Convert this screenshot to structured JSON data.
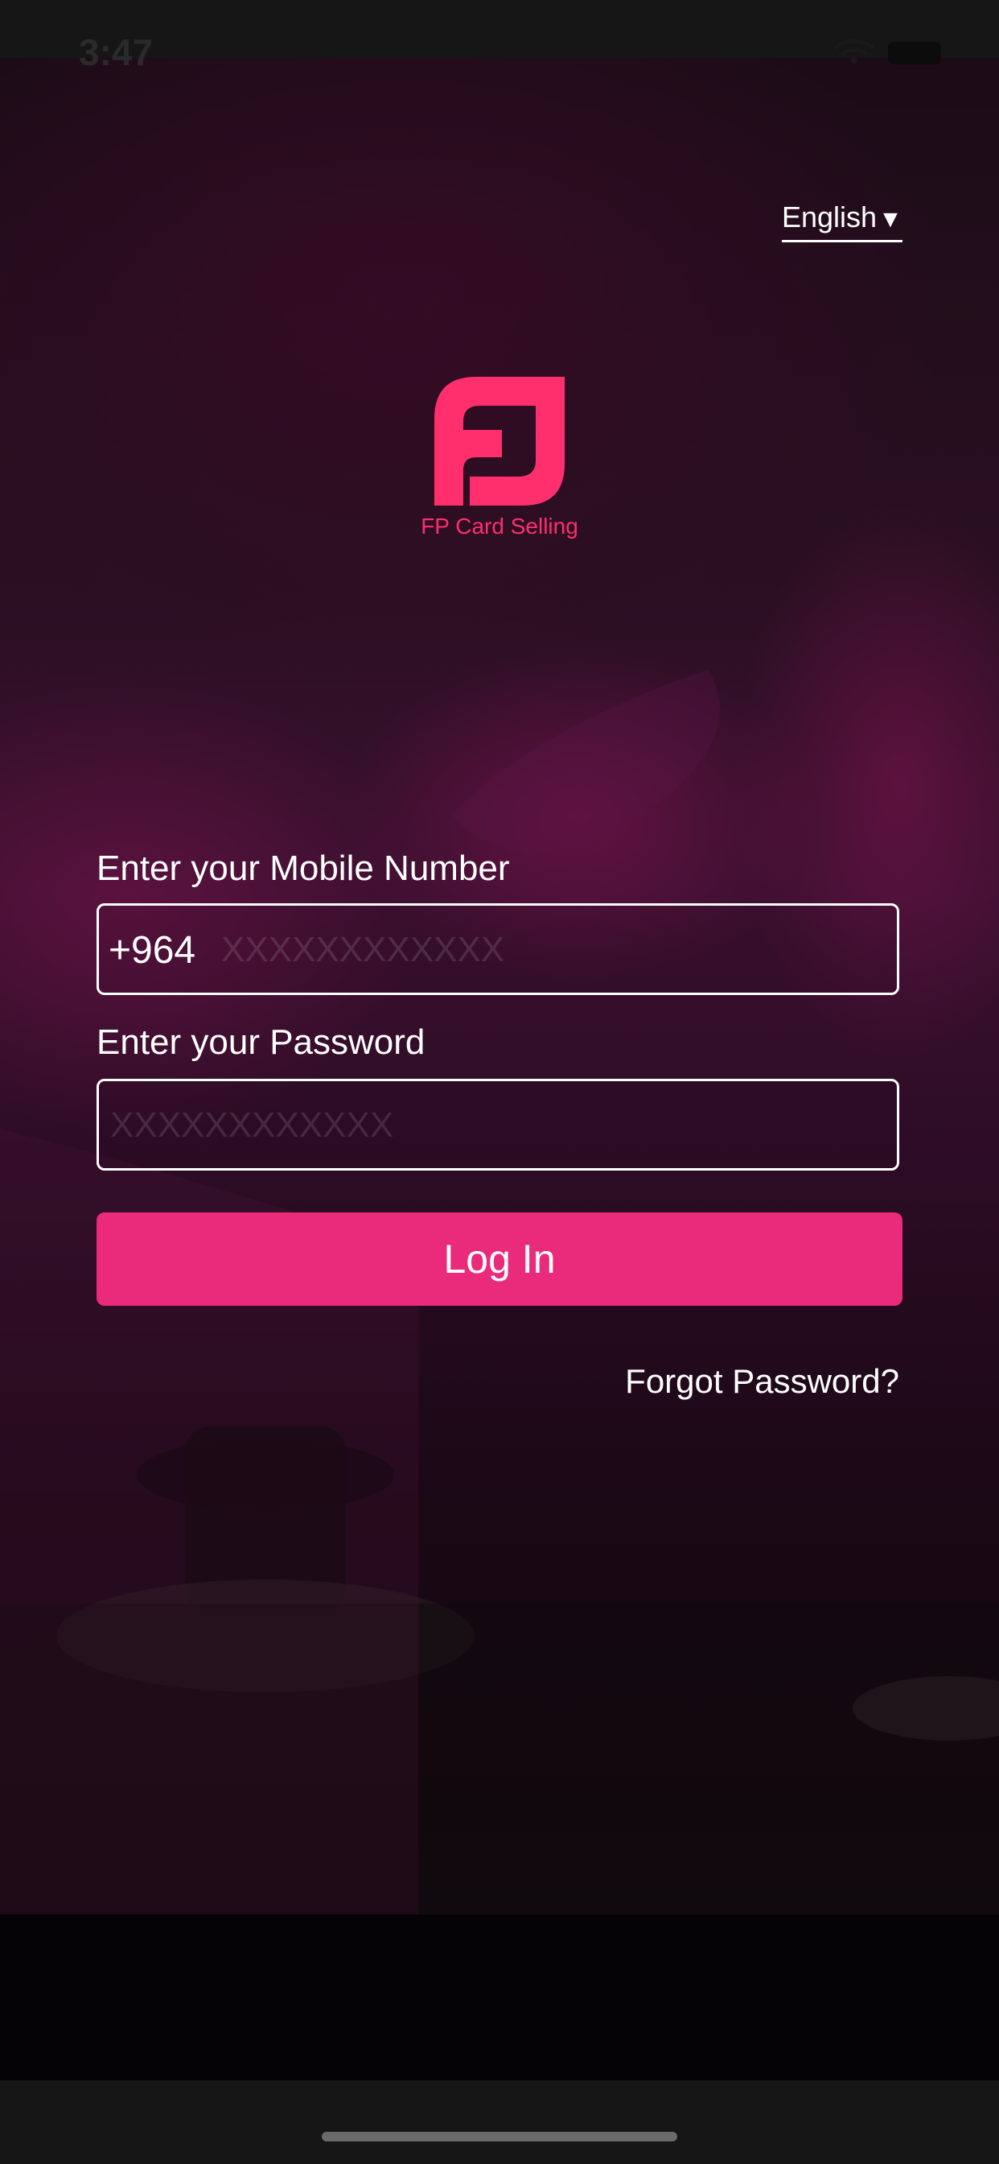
{
  "status_bar": {
    "time": "3:47",
    "icons": [
      "location-arrow-icon",
      "wifi-icon",
      "battery-icon"
    ]
  },
  "language": {
    "selected": "English",
    "caret": "▼"
  },
  "app": {
    "logo_icon": "fp-logo-icon",
    "name": "FP Card Selling"
  },
  "form": {
    "mobile_label": "Enter your Mobile Number",
    "country_code": "+964",
    "mobile_placeholder": "XXXXXXXXXXXX",
    "password_label": "Enter your Password",
    "password_placeholder": "XXXXXXXXXXXX",
    "login_label": "Log In",
    "forgot_label": "Forgot Password?"
  },
  "colors": {
    "accent": "#ea2a7b",
    "logo": "#ff2e6d",
    "overlay": "#3b1030"
  }
}
